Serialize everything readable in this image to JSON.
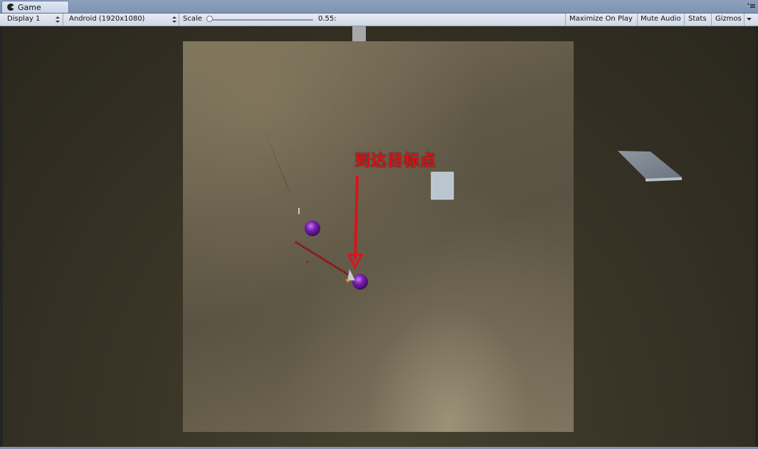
{
  "window": {
    "tab_label": "Game"
  },
  "toolbar": {
    "display": "Display 1",
    "resolution": "Android (1920x1080)",
    "scale_label": "Scale",
    "scale_value": "0.55:",
    "maximize_on_play": "Maximize On Play",
    "mute_audio": "Mute Audio",
    "stats": "Stats",
    "gizmos": "Gizmos"
  },
  "scene": {
    "annotation_text": "到达目标点",
    "annotation_color": "#d8141a",
    "sphere_color": "#7a1fb3",
    "floor_color": "#5f5746"
  },
  "icons": {
    "tab_icon": "pacman-game-icon",
    "tab_menu": "menu-icon",
    "dropdown": "updown-arrows-icon"
  }
}
